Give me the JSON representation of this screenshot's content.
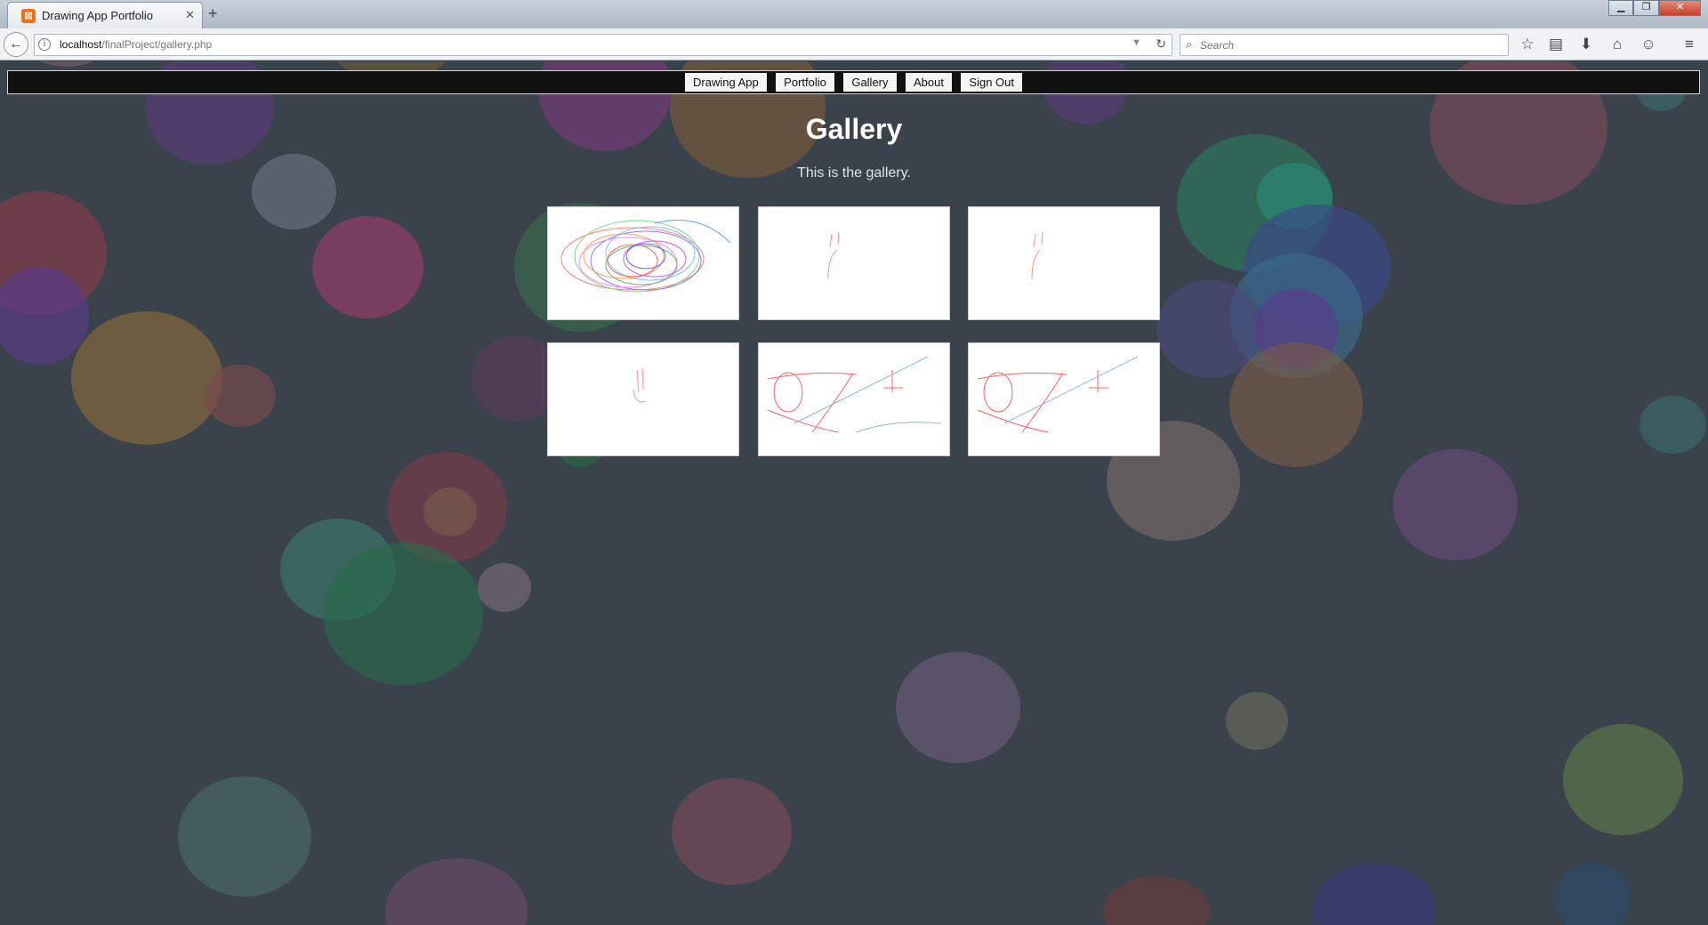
{
  "browser": {
    "tab_title": "Drawing App Portfolio",
    "url_host": "localhost",
    "url_path": "/finalProject/gallery.php",
    "search_placeholder": "Search"
  },
  "nav": {
    "items": [
      {
        "label": "Drawing App"
      },
      {
        "label": "Portfolio"
      },
      {
        "label": "Gallery"
      },
      {
        "label": "About"
      },
      {
        "label": "Sign Out"
      }
    ]
  },
  "main": {
    "title": "Gallery",
    "intro": "This is the gallery."
  },
  "gallery": {
    "thumbnails": [
      {
        "content": "colorful-scribble"
      },
      {
        "content": "red-sketch"
      },
      {
        "content": "red-sketch"
      },
      {
        "content": "red-sketch"
      },
      {
        "content": "fraction-sketch"
      },
      {
        "content": "fraction-sketch"
      }
    ]
  }
}
